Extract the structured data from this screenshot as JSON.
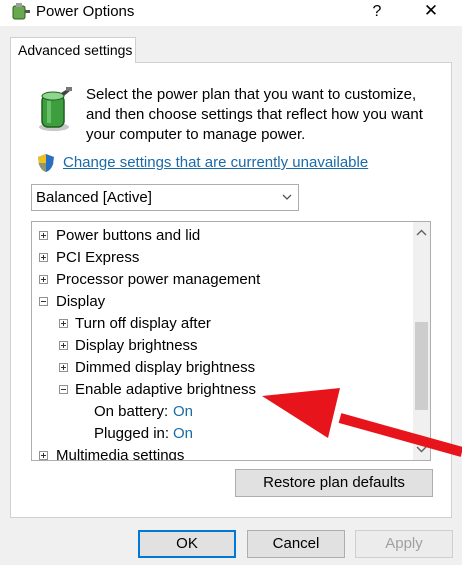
{
  "window": {
    "title": "Power Options",
    "help_glyph": "?",
    "close_glyph": "✕"
  },
  "tab": {
    "label": "Advanced settings"
  },
  "description": "Select the power plan that you want to customize, and then choose settings that reflect how you want your computer to manage power.",
  "change_link": "Change settings that are currently unavailable",
  "plan_select": {
    "value": "Balanced [Active]"
  },
  "tree": {
    "items": [
      {
        "label": "Power buttons and lid",
        "expanded": false
      },
      {
        "label": "PCI Express",
        "expanded": false
      },
      {
        "label": "Processor power management",
        "expanded": false
      },
      {
        "label": "Display",
        "expanded": true
      },
      {
        "label": "Turn off display after",
        "expanded": false
      },
      {
        "label": "Display brightness",
        "expanded": false
      },
      {
        "label": "Dimmed display brightness",
        "expanded": false
      },
      {
        "label": "Enable adaptive brightness",
        "expanded": true
      },
      {
        "label": "On battery:",
        "value": "On"
      },
      {
        "label": "Plugged in:",
        "value": "On"
      },
      {
        "label": "Multimedia settings",
        "expanded": false
      }
    ]
  },
  "buttons": {
    "restore": "Restore plan defaults",
    "ok": "OK",
    "cancel": "Cancel",
    "apply": "Apply"
  },
  "colors": {
    "link": "#1a6aa8",
    "annotation_arrow": "#e8141b",
    "ok_border": "#0078d7"
  }
}
